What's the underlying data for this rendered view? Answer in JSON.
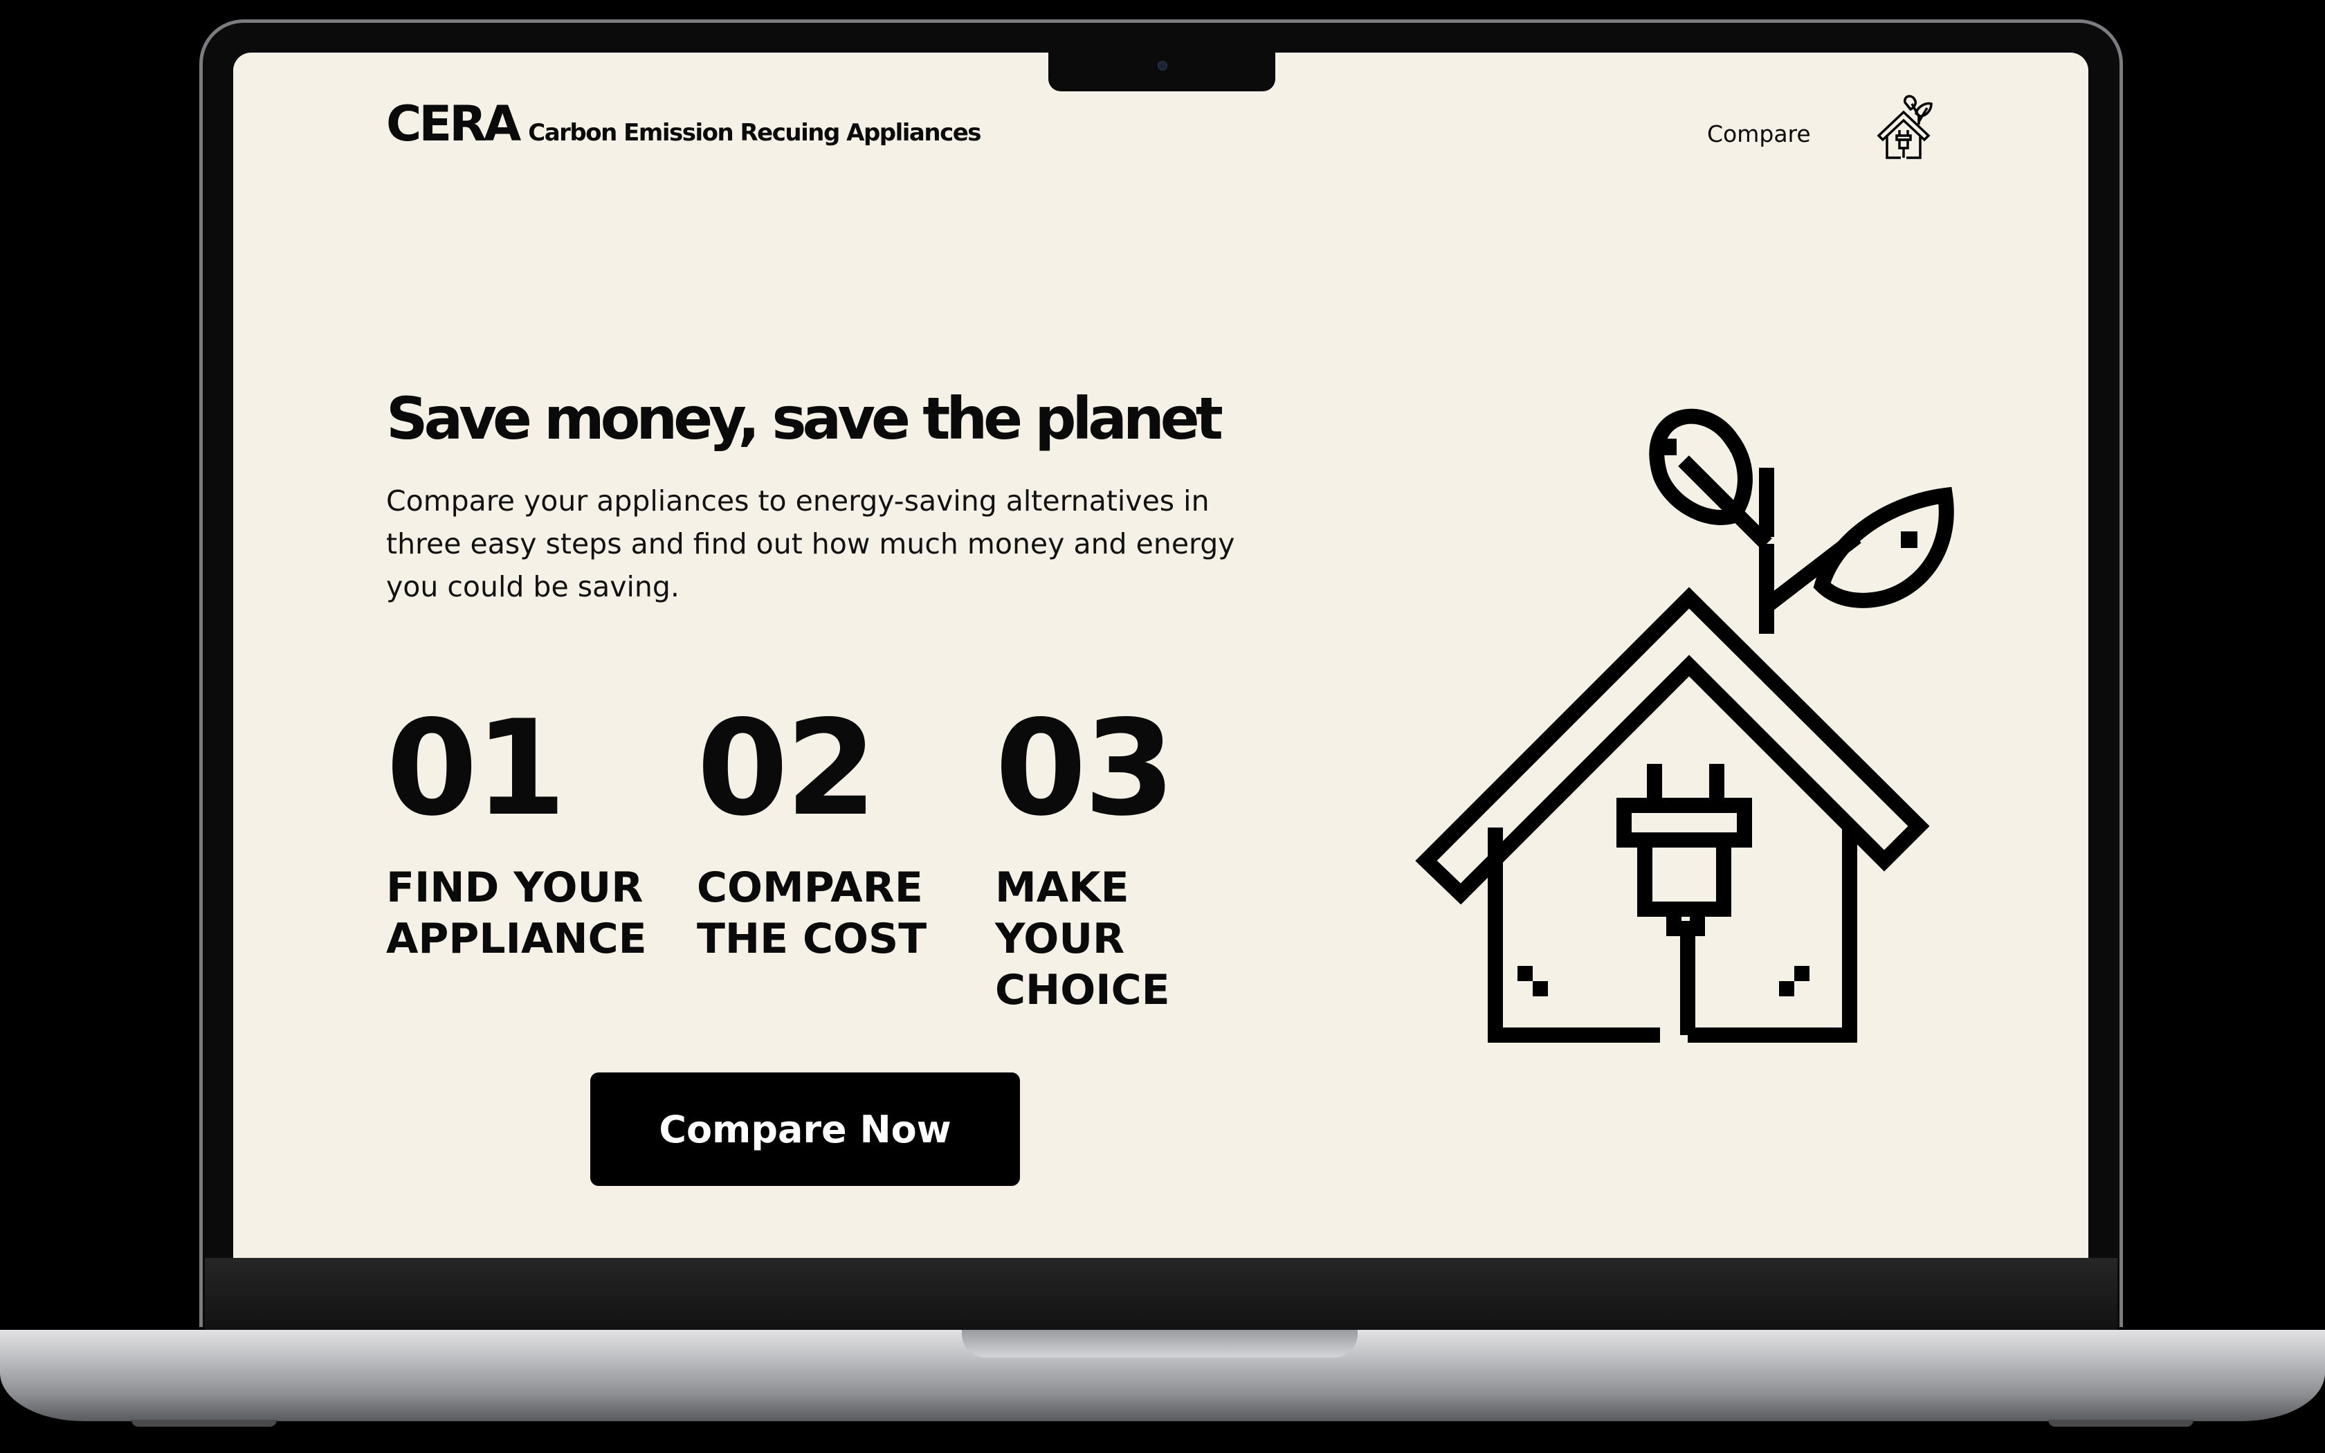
{
  "header": {
    "brand_name": "CERA",
    "brand_tagline": "Carbon Emission Recuing Appliances",
    "nav_compare": "Compare",
    "nav_icon": "eco-house-plug-icon"
  },
  "hero": {
    "title": "Save money, save the planet",
    "description": "Compare your appliances to energy-saving alternatives in three easy steps and find out how much money and energy you could be saving.",
    "illustration_icon": "eco-house-plug-icon"
  },
  "steps": [
    {
      "number": "01",
      "label": "FIND YOUR\nAPPLIANCE"
    },
    {
      "number": "02",
      "label": "COMPARE\nTHE COST"
    },
    {
      "number": "03",
      "label": "MAKE YOUR\nCHOICE"
    }
  ],
  "cta": {
    "label": "Compare Now"
  },
  "colors": {
    "background": "#f6f1e6",
    "text": "#0a0a0a",
    "button_bg": "#000000",
    "button_text": "#ffffff"
  }
}
